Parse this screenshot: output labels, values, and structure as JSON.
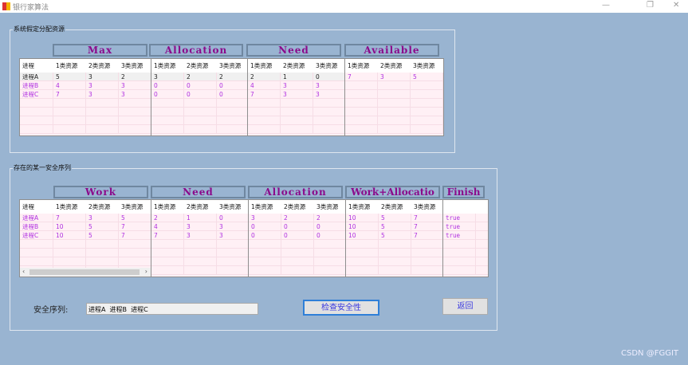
{
  "window": {
    "title": "银行家算法",
    "minimize": "—",
    "maximize": "❐",
    "close": "✕"
  },
  "group1": {
    "label": "系统假定分配资源",
    "headers": [
      "Max",
      "Allocation",
      "Need",
      "Available"
    ],
    "col_header_process": "进程",
    "res_headers": [
      "1类资源",
      "2类资源",
      "3类资源"
    ],
    "processes": [
      "进程A",
      "进程B",
      "进程C"
    ],
    "max": [
      [
        "5",
        "3",
        "2"
      ],
      [
        "4",
        "3",
        "3"
      ],
      [
        "7",
        "3",
        "3"
      ]
    ],
    "allocation": [
      [
        "3",
        "2",
        "2"
      ],
      [
        "0",
        "0",
        "0"
      ],
      [
        "0",
        "0",
        "0"
      ]
    ],
    "need": [
      [
        "2",
        "1",
        "0"
      ],
      [
        "4",
        "3",
        "3"
      ],
      [
        "7",
        "3",
        "3"
      ]
    ],
    "available": [
      [
        "7",
        "3",
        "5"
      ]
    ]
  },
  "group2": {
    "label": "存在的某一安全序列",
    "headers": [
      "Work",
      "Need",
      "Allocation",
      "Work+Allocatio",
      "Finish"
    ],
    "processes": [
      "进程A",
      "进程B",
      "进程C"
    ],
    "work": [
      [
        "7",
        "3",
        "5"
      ],
      [
        "10",
        "5",
        "7"
      ],
      [
        "10",
        "5",
        "7"
      ]
    ],
    "need": [
      [
        "2",
        "1",
        "0"
      ],
      [
        "4",
        "3",
        "3"
      ],
      [
        "7",
        "3",
        "3"
      ]
    ],
    "allocation": [
      [
        "3",
        "2",
        "2"
      ],
      [
        "0",
        "0",
        "0"
      ],
      [
        "0",
        "0",
        "0"
      ]
    ],
    "work_alloc": [
      [
        "10",
        "5",
        "7"
      ],
      [
        "10",
        "5",
        "7"
      ],
      [
        "10",
        "5",
        "7"
      ]
    ],
    "finish": [
      "true",
      "true",
      "true"
    ]
  },
  "bottom": {
    "seq_label": "安全序列:",
    "seq_value": "进程A  进程B  进程C",
    "check_button": "检查安全性",
    "back_button": "返回"
  },
  "watermark": "CSDN @FGGIT",
  "colors": {
    "background": "#99b4d1",
    "header_text": "#8b0a8b",
    "cell_text": "#b030e0"
  }
}
